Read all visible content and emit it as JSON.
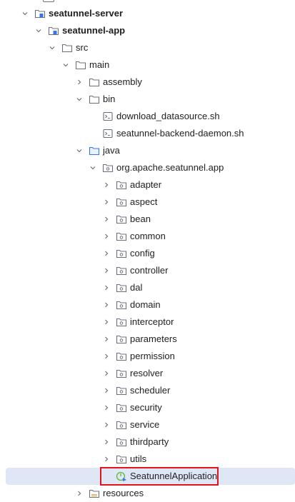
{
  "tree": {
    "rows": [
      {
        "label": "seatunnel-server",
        "depth": 0,
        "state": "expanded",
        "icon": "module-folder-icon",
        "bold": true
      },
      {
        "label": "seatunnel-app",
        "depth": 1,
        "state": "expanded",
        "icon": "module-folder-icon",
        "bold": true
      },
      {
        "label": "src",
        "depth": 2,
        "state": "expanded",
        "icon": "folder-icon"
      },
      {
        "label": "main",
        "depth": 3,
        "state": "expanded",
        "icon": "folder-icon"
      },
      {
        "label": "assembly",
        "depth": 4,
        "state": "collapsed",
        "icon": "folder-icon"
      },
      {
        "label": "bin",
        "depth": 4,
        "state": "expanded",
        "icon": "folder-icon"
      },
      {
        "label": "download_datasource.sh",
        "depth": 5,
        "state": "leaf",
        "icon": "shell-script-icon"
      },
      {
        "label": "seatunnel-backend-daemon.sh",
        "depth": 5,
        "state": "leaf",
        "icon": "shell-script-icon"
      },
      {
        "label": "java",
        "depth": 4,
        "state": "expanded",
        "icon": "source-folder-icon"
      },
      {
        "label": "org.apache.seatunnel.app",
        "depth": 5,
        "state": "expanded",
        "icon": "package-icon"
      },
      {
        "label": "adapter",
        "depth": 6,
        "state": "collapsed",
        "icon": "package-icon"
      },
      {
        "label": "aspect",
        "depth": 6,
        "state": "collapsed",
        "icon": "package-icon"
      },
      {
        "label": "bean",
        "depth": 6,
        "state": "collapsed",
        "icon": "package-icon"
      },
      {
        "label": "common",
        "depth": 6,
        "state": "collapsed",
        "icon": "package-icon"
      },
      {
        "label": "config",
        "depth": 6,
        "state": "collapsed",
        "icon": "package-icon"
      },
      {
        "label": "controller",
        "depth": 6,
        "state": "collapsed",
        "icon": "package-icon"
      },
      {
        "label": "dal",
        "depth": 6,
        "state": "collapsed",
        "icon": "package-icon"
      },
      {
        "label": "domain",
        "depth": 6,
        "state": "collapsed",
        "icon": "package-icon"
      },
      {
        "label": "interceptor",
        "depth": 6,
        "state": "collapsed",
        "icon": "package-icon"
      },
      {
        "label": "parameters",
        "depth": 6,
        "state": "collapsed",
        "icon": "package-icon"
      },
      {
        "label": "permission",
        "depth": 6,
        "state": "collapsed",
        "icon": "package-icon"
      },
      {
        "label": "resolver",
        "depth": 6,
        "state": "collapsed",
        "icon": "package-icon"
      },
      {
        "label": "scheduler",
        "depth": 6,
        "state": "collapsed",
        "icon": "package-icon"
      },
      {
        "label": "security",
        "depth": 6,
        "state": "collapsed",
        "icon": "package-icon"
      },
      {
        "label": "service",
        "depth": 6,
        "state": "collapsed",
        "icon": "package-icon"
      },
      {
        "label": "thirdparty",
        "depth": 6,
        "state": "collapsed",
        "icon": "package-icon"
      },
      {
        "label": "utils",
        "depth": 6,
        "state": "collapsed",
        "icon": "package-icon"
      },
      {
        "label": "SeatunnelApplication",
        "depth": 6,
        "state": "leaf",
        "icon": "spring-boot-app-icon",
        "selected": true,
        "highlighted": true
      },
      {
        "label": "resources",
        "depth": 4,
        "state": "collapsed",
        "icon": "resources-folder-icon"
      }
    ]
  },
  "colors": {
    "selection": "#dfe7f7",
    "highlight_border": "#e1141a",
    "icon_stroke": "#6c707e",
    "source_folder": "#3574f0",
    "spring": "#5fb832"
  }
}
